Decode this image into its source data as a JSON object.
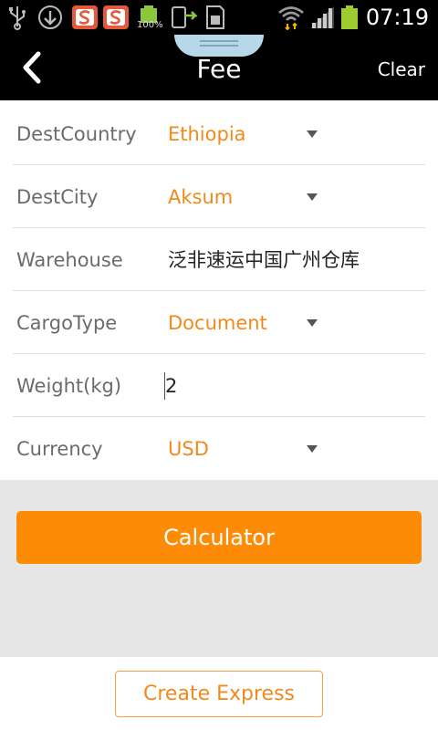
{
  "status_bar": {
    "time": "07:19",
    "battery_badge": "100%",
    "icons": [
      "usb-icon",
      "download-icon",
      "sogou-s-icon",
      "sogou-s-icon",
      "battery-full-icon",
      "phone-sync-icon",
      "sd-card-icon",
      "wifi-icon",
      "signal-icon",
      "battery-icon"
    ]
  },
  "header": {
    "title": "Fee",
    "clear_label": "Clear",
    "back_icon": "chevron-left-icon"
  },
  "form": {
    "dest_country": {
      "label": "DestCountry",
      "value": "Ethiopia"
    },
    "dest_city": {
      "label": "DestCity",
      "value": "Aksum"
    },
    "warehouse": {
      "label": "Warehouse",
      "value": "泛非速运中国广州仓库"
    },
    "cargo_type": {
      "label": "CargoType",
      "value": "Document"
    },
    "weight": {
      "label": "Weight(kg)",
      "value": "2"
    },
    "currency": {
      "label": "Currency",
      "value": "USD"
    }
  },
  "actions": {
    "calculator_label": "Calculator",
    "create_express_label": "Create Express"
  },
  "colors": {
    "accent_orange": "#fd8b05",
    "value_orange": "#f08a1c",
    "bar_black": "#000000",
    "background_grey": "#e6e6e6"
  }
}
